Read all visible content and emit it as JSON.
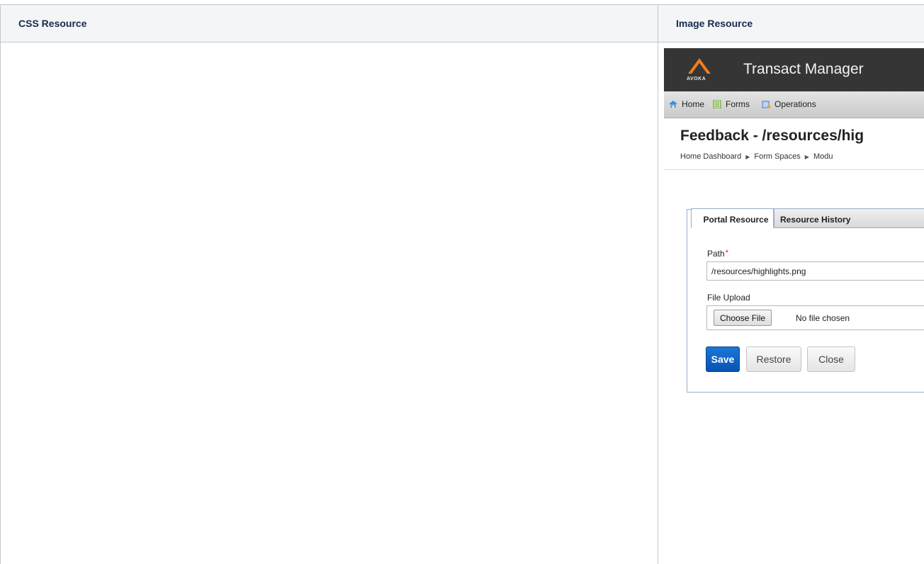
{
  "table": {
    "headers": [
      "CSS Resource",
      "Image Resource"
    ]
  },
  "screenshot": {
    "logo_text": "AVOKA",
    "app_title": "Transact Manager",
    "nav": [
      {
        "label": "Home",
        "icon": "home-icon"
      },
      {
        "label": "Forms",
        "icon": "forms-icon"
      },
      {
        "label": "Operations",
        "icon": "operations-icon"
      }
    ],
    "page_title": "Feedback - /resources/hig",
    "breadcrumb": [
      "Home Dashboard",
      "Form Spaces",
      "Modu"
    ],
    "tabs": [
      "Portal Resource",
      "Resource History"
    ],
    "form": {
      "path_label": "Path",
      "required_mark": "*",
      "path_value": "/resources/highlights.png",
      "upload_label": "File Upload",
      "choose_file_label": "Choose File",
      "no_file_text": "No file chosen"
    },
    "buttons": {
      "save": "Save",
      "restore": "Restore",
      "close": "Close"
    }
  },
  "colors": {
    "header_bg": "#353535",
    "logo_orange": "#f07c1c",
    "save_blue": "#0a63c7",
    "panel_border": "#9aaec6"
  }
}
